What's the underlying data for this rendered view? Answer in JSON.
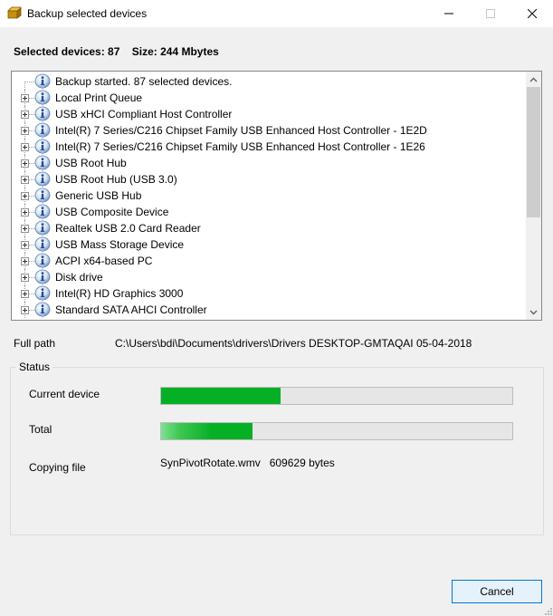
{
  "window": {
    "title": "Backup selected devices",
    "icon": "box-icon",
    "controls": {
      "minimize": "minimize-icon",
      "maximize": "maximize-icon",
      "close": "close-icon"
    }
  },
  "summary": {
    "selected_devices": "Selected devices: 87",
    "size": "Size: 244 Mbytes"
  },
  "tree": {
    "items": [
      {
        "label": "Backup started. 87 selected devices.",
        "icon": "info-icon",
        "expandable": false
      },
      {
        "label": "Local Print Queue",
        "icon": "info-icon",
        "expandable": true
      },
      {
        "label": "USB xHCI Compliant Host Controller",
        "icon": "info-icon",
        "expandable": true
      },
      {
        "label": "Intel(R) 7 Series/C216 Chipset Family USB Enhanced Host Controller - 1E2D",
        "icon": "info-icon",
        "expandable": true
      },
      {
        "label": "Intel(R) 7 Series/C216 Chipset Family USB Enhanced Host Controller - 1E26",
        "icon": "info-icon",
        "expandable": true
      },
      {
        "label": "USB Root Hub",
        "icon": "info-icon",
        "expandable": true
      },
      {
        "label": "USB Root Hub (USB 3.0)",
        "icon": "info-icon",
        "expandable": true
      },
      {
        "label": "Generic USB Hub",
        "icon": "info-icon",
        "expandable": true
      },
      {
        "label": "USB Composite Device",
        "icon": "info-icon",
        "expandable": true
      },
      {
        "label": "Realtek USB 2.0 Card Reader",
        "icon": "info-icon",
        "expandable": true
      },
      {
        "label": "USB Mass Storage Device",
        "icon": "info-icon",
        "expandable": true
      },
      {
        "label": "ACPI x64-based PC",
        "icon": "info-icon",
        "expandable": true
      },
      {
        "label": "Disk drive",
        "icon": "info-icon",
        "expandable": true
      },
      {
        "label": "Intel(R) HD Graphics 3000",
        "icon": "info-icon",
        "expandable": true
      },
      {
        "label": "Standard SATA AHCI Controller",
        "icon": "info-icon",
        "expandable": true
      }
    ]
  },
  "full_path": {
    "label": "Full path",
    "value": "C:\\Users\\bdi\\Documents\\drivers\\Drivers DESKTOP-GMTAQAI 05-04-2018"
  },
  "status": {
    "title": "Status",
    "current_device": {
      "label": "Current device",
      "progress_percent": 34
    },
    "total": {
      "label": "Total",
      "progress_percent": 26
    },
    "copying_file": {
      "label": "Copying file",
      "value": "SynPivotRotate.wmv   609629 bytes"
    }
  },
  "colors": {
    "progress_fill": "#06b025",
    "button_border": "#0078d7",
    "button_bg": "#e5f1fb"
  },
  "buttons": {
    "cancel": "Cancel"
  }
}
